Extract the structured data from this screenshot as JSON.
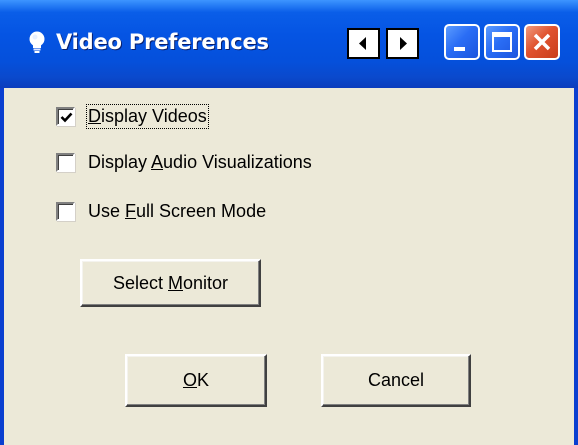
{
  "window": {
    "title": "Video Preferences"
  },
  "titlebar": {
    "icons": [
      "lightbulb-icon",
      "arrow-left-icon",
      "arrow-right-icon",
      "minimize-icon",
      "maximize-icon",
      "close-icon"
    ]
  },
  "options": [
    {
      "label_pre": "",
      "mnemonic": "D",
      "label_post": "isplay Videos",
      "checked": true
    },
    {
      "label_pre": "Display ",
      "mnemonic": "A",
      "label_post": "udio Visualizations",
      "checked": false
    },
    {
      "label_pre": "Use ",
      "mnemonic": "F",
      "label_post": "ull Screen Mode",
      "checked": false
    }
  ],
  "select_monitor": {
    "label_pre": "Select ",
    "mnemonic": "M",
    "label_post": "onitor"
  },
  "ok_button": {
    "mnemonic": "O",
    "label_post": "K"
  },
  "cancel_button": {
    "label": "Cancel"
  },
  "colors": {
    "titlebar": "#0554e3",
    "frame": "#0a3fd0",
    "dialog_bg": "#ece9d8",
    "close_button": "#e0532f"
  }
}
